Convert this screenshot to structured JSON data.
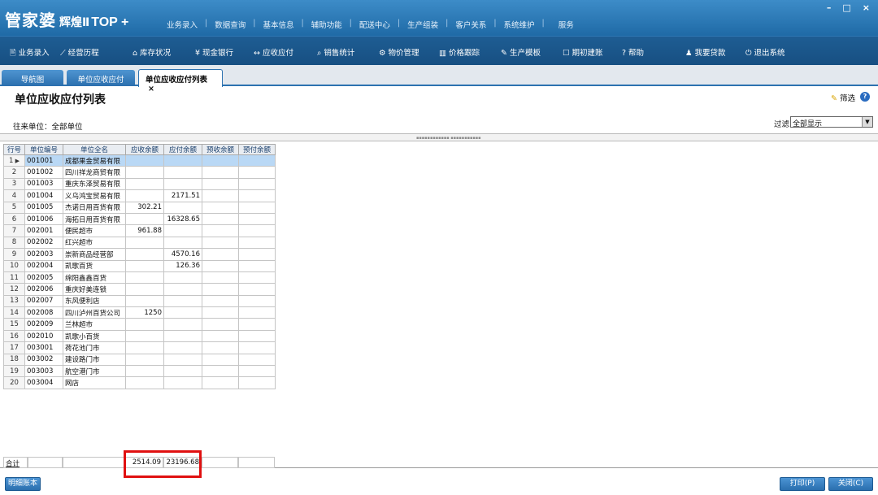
{
  "app": {
    "logo_main": "管家婆",
    "logo_sub": "辉煌Ⅱ",
    "logo_ver": "TOP +",
    "window_controls": [
      "–",
      "□",
      "×"
    ]
  },
  "top_menu": [
    "业务录入",
    "数据查询",
    "基本信息",
    "辅助功能",
    "配送中心",
    "生产组装",
    "客户关系",
    "系统维护",
    "服务"
  ],
  "toolbar": [
    {
      "label": "业务录入",
      "icon": "🖹"
    },
    {
      "label": "经营历程",
      "icon": "⟋"
    },
    {
      "label": "库存状况",
      "icon": "⌂"
    },
    {
      "label": "现金银行",
      "icon": "¥"
    },
    {
      "label": "应收应付",
      "icon": "↔"
    },
    {
      "label": "销售统计",
      "icon": "⌕"
    },
    {
      "label": "物价管理",
      "icon": "⚙"
    },
    {
      "label": "价格跟踪",
      "icon": "▥"
    },
    {
      "label": "生产模板",
      "icon": "✎"
    },
    {
      "label": "期初建账",
      "icon": "☐"
    },
    {
      "label": "帮助",
      "icon": "?"
    },
    {
      "label": "我要贷款",
      "icon": "♟"
    },
    {
      "label": "退出系统",
      "icon": "⏻"
    }
  ],
  "tabs": [
    {
      "label": "导航图"
    },
    {
      "label": "单位应收应付"
    },
    {
      "label": "单位应收应付列表",
      "close": "×"
    }
  ],
  "page_title": "单位应收应付列表",
  "filter_button": "筛选",
  "help_icon": "?",
  "unit_label": "往来单位：全部单位",
  "filter_label": "过滤",
  "filter_select": {
    "value": "全部显示",
    "arrow": "▼"
  },
  "grid": {
    "headers": [
      "行号",
      "单位编号",
      "单位全名",
      "应收余额",
      "应付余额",
      "预收余额",
      "预付余额"
    ],
    "rows": [
      [
        "1",
        "001001",
        "成都果金贸易有限",
        "",
        "",
        "",
        ""
      ],
      [
        "2",
        "001002",
        "四川祥龙商贸有限",
        "",
        "",
        "",
        ""
      ],
      [
        "3",
        "001003",
        "重庆东泽贸易有限",
        "",
        "",
        "",
        ""
      ],
      [
        "4",
        "001004",
        "义乌鸿宝贸易有限",
        "",
        "2171.51",
        "",
        ""
      ],
      [
        "5",
        "001005",
        "杰诺日用百货有限",
        "302.21",
        "",
        "",
        ""
      ],
      [
        "6",
        "001006",
        "海拓日用百货有限",
        "",
        "16328.65",
        "",
        ""
      ],
      [
        "7",
        "002001",
        "便民超市",
        "961.88",
        "",
        "",
        ""
      ],
      [
        "8",
        "002002",
        "红兴超市",
        "",
        "",
        "",
        ""
      ],
      [
        "9",
        "002003",
        "崇新商品经营部",
        "",
        "4570.16",
        "",
        ""
      ],
      [
        "10",
        "002004",
        "凯歌百货",
        "",
        "126.36",
        "",
        ""
      ],
      [
        "11",
        "002005",
        "绵阳鑫鑫百货",
        "",
        "",
        "",
        ""
      ],
      [
        "12",
        "002006",
        "重庆好美连锁",
        "",
        "",
        "",
        ""
      ],
      [
        "13",
        "002007",
        "东风便利店",
        "",
        "",
        "",
        ""
      ],
      [
        "14",
        "002008",
        "四川泸州百货公司",
        "1250",
        "",
        "",
        ""
      ],
      [
        "15",
        "002009",
        "兰林超市",
        "",
        "",
        "",
        ""
      ],
      [
        "16",
        "002010",
        "凯歌小百货",
        "",
        "",
        "",
        ""
      ],
      [
        "17",
        "003001",
        "荷花池门市",
        "",
        "",
        "",
        ""
      ],
      [
        "18",
        "003002",
        "建设路门市",
        "",
        "",
        "",
        ""
      ],
      [
        "19",
        "003003",
        "航空港门市",
        "",
        "",
        "",
        ""
      ],
      [
        "20",
        "003004",
        "网店",
        "",
        "",
        "",
        ""
      ]
    ],
    "selected_row": "1"
  },
  "totals": {
    "label": "合计",
    "receivable": "2514.09",
    "payable": "23196.68"
  },
  "buttons": {
    "ledger": "明细账本",
    "print": "打印(P)",
    "close": "关闭(C)"
  },
  "accent_colors": {
    "highlight_box": "#e01010",
    "selected_row": "#b9d8f5"
  }
}
